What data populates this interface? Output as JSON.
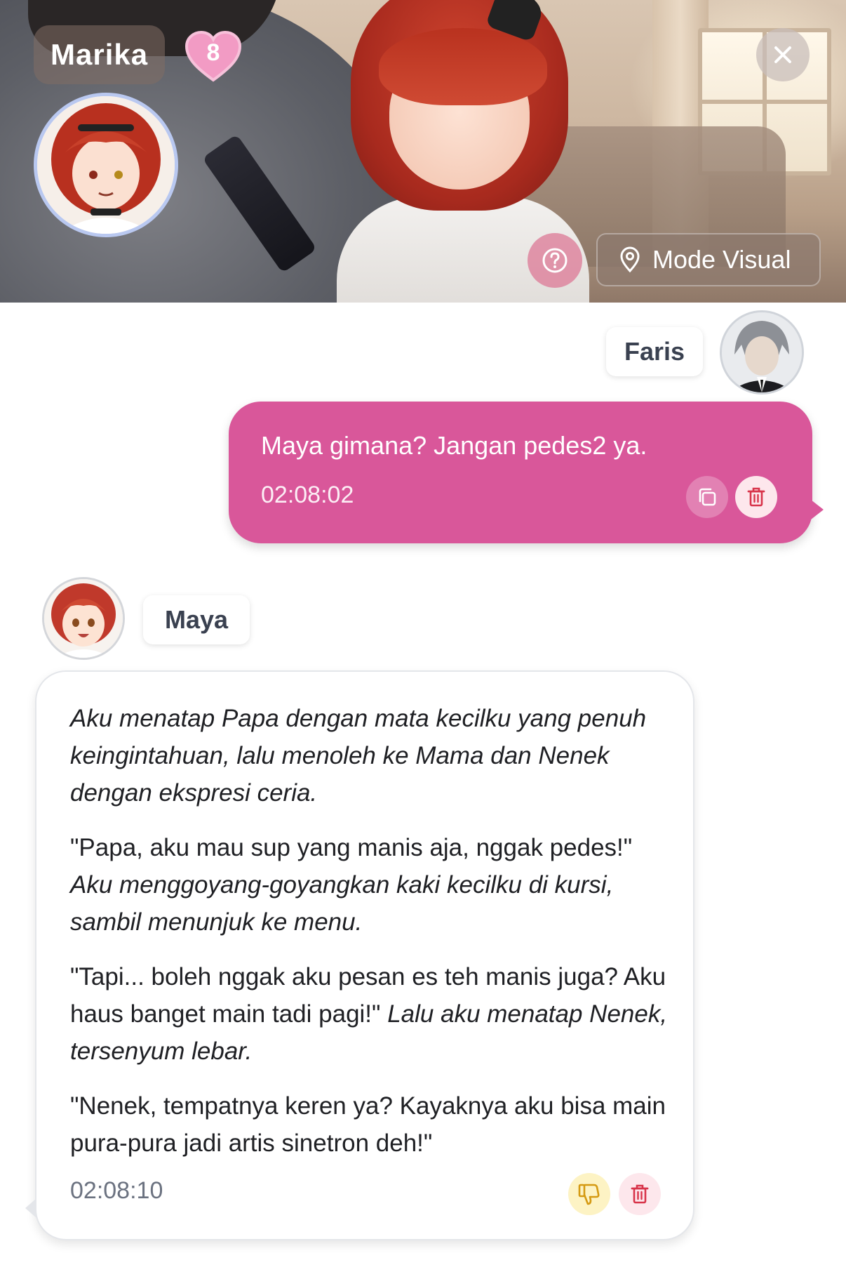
{
  "header": {
    "character_name": "Marika",
    "affection_level": "8",
    "mode_button_label": "Mode Visual"
  },
  "messages": [
    {
      "sender": "Faris",
      "role": "user",
      "text": "Maya gimana? Jangan pedes2 ya.",
      "time": "02:08:02"
    },
    {
      "sender": "Maya",
      "role": "character",
      "paragraphs": [
        {
          "italic": "Aku menatap Papa dengan mata kecilku yang penuh keingintahuan, lalu menoleh ke Mama dan Nenek dengan ekspresi ceria."
        },
        {
          "quote": "\"Papa, aku mau sup yang manis aja, nggak pedes!\"",
          "italic": "Aku menggoyang-goyangkan kaki kecilku di kursi, sambil menunjuk ke menu."
        },
        {
          "quote": "\"Tapi... boleh nggak aku pesan es teh manis juga? Aku haus banget main tadi pagi!\"",
          "italic": "Lalu aku menatap Nenek, tersenyum lebar."
        },
        {
          "quote": "\"Nenek, tempatnya keren ya? Kayaknya aku bisa main pura-pura jadi artis sinetron deh!\""
        }
      ],
      "time": "02:08:10"
    }
  ],
  "colors": {
    "user_bubble": "#d9579a",
    "heart": "#f29bc4",
    "dislike_bg": "#fdf3c4",
    "delete_bg": "#fde7ec",
    "delete_icon": "#d8344a"
  },
  "icons": {
    "close": "close-icon",
    "help": "question-circle-icon",
    "mode": "map-pin-icon",
    "copy": "copy-icon",
    "delete": "trash-icon",
    "dislike": "thumbs-down-icon",
    "heart": "heart-icon"
  }
}
